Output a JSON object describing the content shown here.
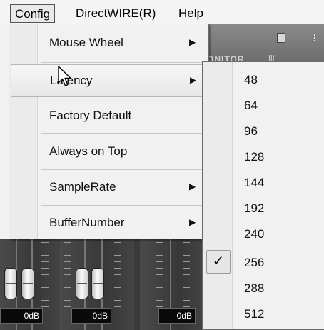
{
  "menubar": {
    "items": [
      {
        "label": "Config",
        "active": true
      },
      {
        "label": "DirectWIRE(R)",
        "active": false
      },
      {
        "label": "Help",
        "active": false
      }
    ]
  },
  "config_menu": {
    "items": [
      {
        "label": "Mouse Wheel",
        "has_submenu": true
      },
      {
        "label": "Latency",
        "has_submenu": true,
        "hovered": true
      },
      {
        "label": "Factory Default",
        "has_submenu": false
      },
      {
        "label": "Always on Top",
        "has_submenu": false
      },
      {
        "label": "SampleRate",
        "has_submenu": true
      },
      {
        "label": "BufferNumber",
        "has_submenu": true
      }
    ],
    "submenu_arrow": "▶"
  },
  "latency_menu": {
    "items": [
      "48",
      "64",
      "96",
      "128",
      "144",
      "192",
      "240",
      "256",
      "288",
      "512"
    ],
    "checked": "256",
    "check_glyph": "✓"
  },
  "background": {
    "monitor_label": "ONITOR",
    "db_labels": [
      "0dB",
      "0dB",
      "0dB"
    ]
  }
}
